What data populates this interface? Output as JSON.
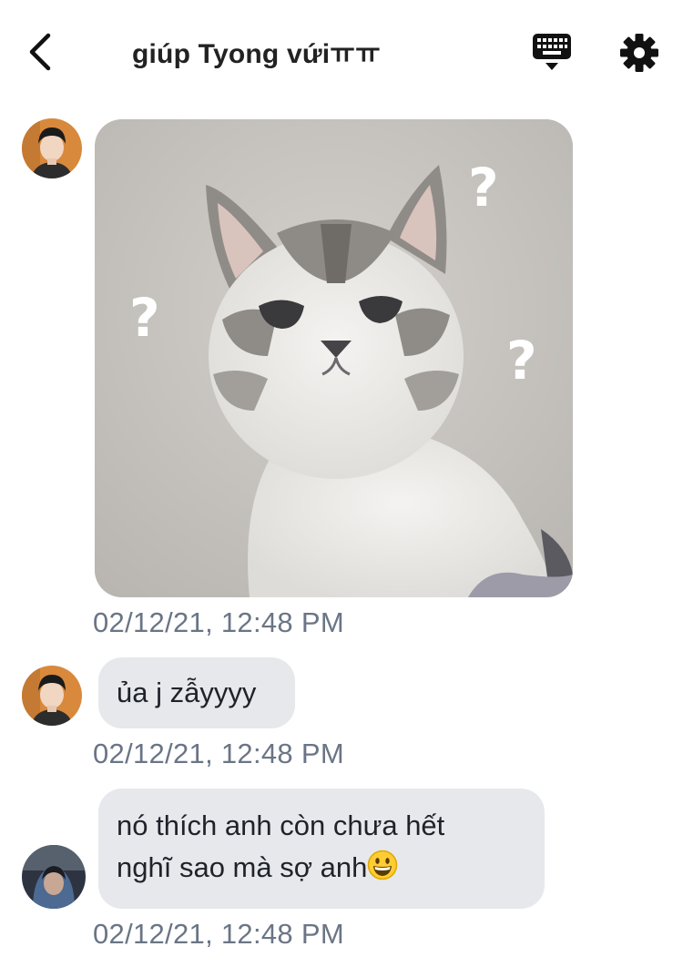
{
  "header": {
    "title": "giúp Tyong vứiㅠㅠ",
    "back_icon": "chevron-left-icon",
    "keyboard_icon": "keyboard-icon",
    "settings_icon": "gear-icon"
  },
  "messages": [
    {
      "type": "image",
      "image_description_icon": "cat-photo",
      "timestamp": "02/12/21, 12:48 PM"
    },
    {
      "type": "text",
      "text": "ủa j zẫyyyy",
      "timestamp": "02/12/21, 12:48 PM"
    },
    {
      "type": "text",
      "lines": [
        "nó thích anh còn chưa hết",
        "nghĩ sao mà sợ anh"
      ],
      "emoji": "grinning-face-emoji",
      "timestamp": "02/12/21, 12:48 PM"
    }
  ],
  "colors": {
    "bubble": "#e6e8ec",
    "timestamp": "#6a7585",
    "text": "#1f2329"
  }
}
